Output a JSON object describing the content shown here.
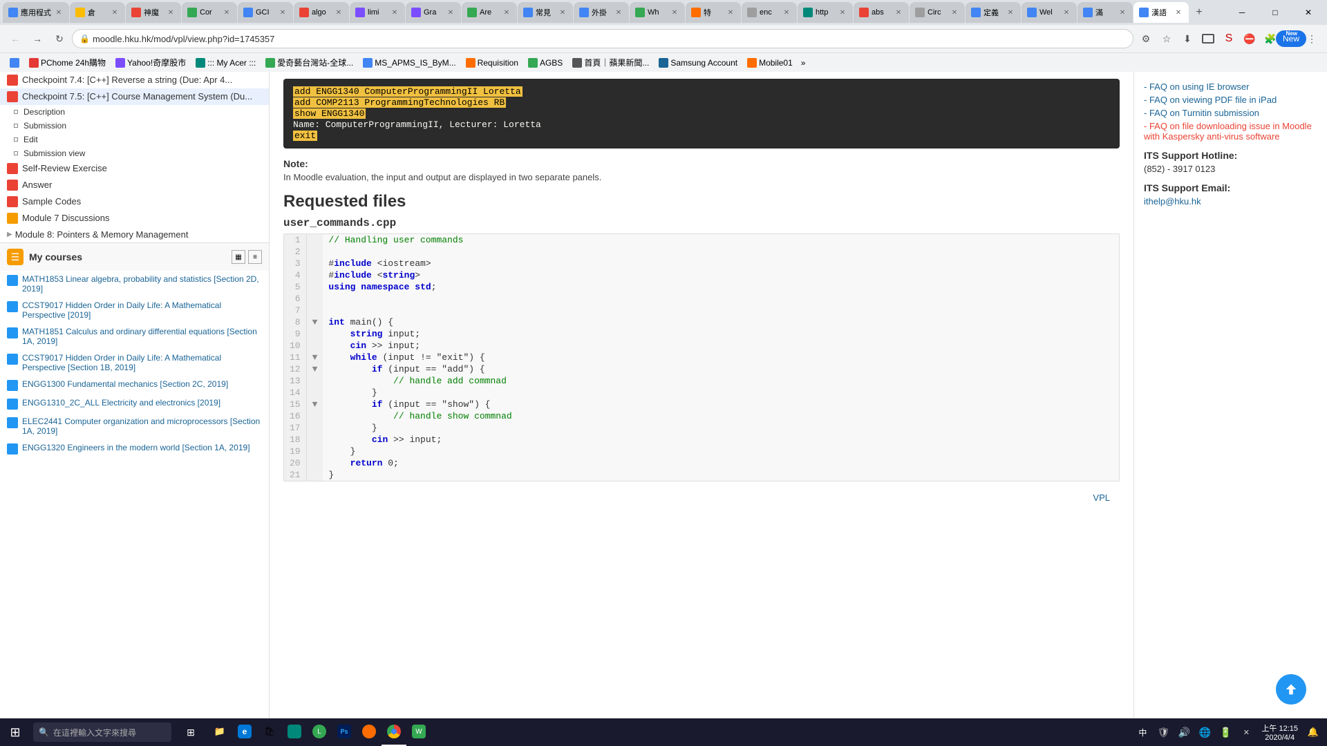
{
  "browser": {
    "tabs": [
      {
        "id": 1,
        "title": "應用程式",
        "favicon_color": "#4285f4",
        "active": false
      },
      {
        "id": 2,
        "title": "倉",
        "favicon_color": "#fbbc05",
        "active": false
      },
      {
        "id": 3,
        "title": "神魔",
        "favicon_color": "#ea4335",
        "active": false
      },
      {
        "id": 4,
        "title": "Cor",
        "favicon_color": "#34a853",
        "active": false
      },
      {
        "id": 5,
        "title": "GCI",
        "favicon_color": "#4285f4",
        "active": false
      },
      {
        "id": 6,
        "title": "algo",
        "favicon_color": "#ea4335",
        "active": false
      },
      {
        "id": 7,
        "title": "limi",
        "favicon_color": "#7c4dff",
        "active": false
      },
      {
        "id": 8,
        "title": "Gra",
        "favicon_color": "#7c4dff",
        "active": false
      },
      {
        "id": 9,
        "title": "Are",
        "favicon_color": "#34a853",
        "active": false
      },
      {
        "id": 10,
        "title": "常見",
        "favicon_color": "#4285f4",
        "active": false
      },
      {
        "id": 11,
        "title": "外掛",
        "favicon_color": "#4285f4",
        "active": false
      },
      {
        "id": 12,
        "title": "Wh",
        "favicon_color": "#34a853",
        "active": false
      },
      {
        "id": 13,
        "title": "特",
        "favicon_color": "#ff6d00",
        "active": false
      },
      {
        "id": 14,
        "title": "enc",
        "favicon_color": "#9e9e9e",
        "active": false
      },
      {
        "id": 15,
        "title": "http",
        "favicon_color": "#00897b",
        "active": false
      },
      {
        "id": 16,
        "title": "abs",
        "favicon_color": "#ea4335",
        "active": false
      },
      {
        "id": 17,
        "title": "Circ",
        "favicon_color": "#9e9e9e",
        "active": false
      },
      {
        "id": 18,
        "title": "定義",
        "favicon_color": "#4285f4",
        "active": false
      },
      {
        "id": 19,
        "title": "Wel",
        "favicon_color": "#4285f4",
        "active": false
      },
      {
        "id": 20,
        "title": "滿",
        "favicon_color": "#4285f4",
        "active": false
      },
      {
        "id": 21,
        "title": "漢語",
        "favicon_color": "#4285f4",
        "active": true
      }
    ],
    "address": "moodle.hku.hk/mod/vpl/view.php?id=1745357",
    "new_badge": "New"
  },
  "bookmarks": [
    {
      "label": "應用程式",
      "has_icon": true
    },
    {
      "label": "PChome 24h購物",
      "has_icon": true
    },
    {
      "label": "Yahoo!奇摩股市",
      "has_icon": true
    },
    {
      "label": "::: My Acer :::",
      "has_icon": true
    },
    {
      "label": "愛奇藝台灣站-全球...",
      "has_icon": true
    },
    {
      "label": "MS_APMS_IS_ByM...",
      "has_icon": true
    },
    {
      "label": "Requisition",
      "has_icon": true
    },
    {
      "label": "AGBS",
      "has_icon": true
    },
    {
      "label": "首頁｜蘋果新聞...",
      "has_icon": true
    },
    {
      "label": "Samsung Account",
      "has_icon": true
    },
    {
      "label": "Mobile01",
      "has_icon": true
    }
  ],
  "sidebar": {
    "checkpoint_74": {
      "label": "Checkpoint 7.4: [C++] Reverse a string (Due: Apr 4...",
      "icon_color": "#ea4335"
    },
    "checkpoint_75": {
      "label": "Checkpoint 7.5: [C++] Course Management System (Du...",
      "icon_color": "#ea4335",
      "active": true
    },
    "sub_items": [
      "Description",
      "Submission",
      "Edit",
      "Submission view"
    ],
    "self_review": {
      "label": "Self-Review Exercise",
      "icon_color": "#ea4335"
    },
    "answer": {
      "label": "Answer",
      "icon_color": "#ea4335"
    },
    "sample_codes": {
      "label": "Sample Codes",
      "icon_color": "#ea4335"
    },
    "module7_discussions": {
      "label": "Module 7 Discussions",
      "icon_color": "#f59c00"
    },
    "module8": {
      "label": "Module 8: Pointers & Memory Management"
    }
  },
  "my_courses": {
    "title": "My courses",
    "items": [
      {
        "label": "MATH1853 Linear algebra, probability and statistics [Section 2D, 2019]",
        "icon_color": "#2196F3"
      },
      {
        "label": "CCST9017 Hidden Order in Daily Life: A Mathematical Perspective [2019]",
        "icon_color": "#2196F3"
      },
      {
        "label": "MATH1851 Calculus and ordinary differential equations [Section 1A, 2019]",
        "icon_color": "#2196F3"
      },
      {
        "label": "CCST9017 Hidden Order in Daily Life: A Mathematical Perspective [Section 1B, 2019]",
        "icon_color": "#2196F3"
      },
      {
        "label": "ENGG1300 Fundamental mechanics [Section 2C, 2019]",
        "icon_color": "#2196F3"
      },
      {
        "label": "ENGG1310_2C_ALL Electricity and electronics [2019]",
        "icon_color": "#2196F3"
      },
      {
        "label": "ELEC2441 Computer organization and microprocessors [Section 1A, 2019]",
        "icon_color": "#2196F3"
      },
      {
        "label": "ENGG1320 Engineers in the modern world [Section 1A, 2019]",
        "icon_color": "#2196F3"
      }
    ]
  },
  "terminal": {
    "lines": [
      {
        "text": "add ENGG1340 ComputerProgrammingII Loretta",
        "highlight": true
      },
      {
        "text": "add COMP2113 ProgrammingTechnologies RB",
        "highlight": true
      },
      {
        "text": "show ENGG1340",
        "highlight": true
      },
      {
        "text": "Name: ComputerProgrammingII, Lecturer: Loretta",
        "highlight": false
      },
      {
        "text": "exit",
        "highlight": true
      }
    ]
  },
  "note": {
    "label": "Note:",
    "text": "In Moodle evaluation, the input and output are displayed in two separate panels."
  },
  "requested_files": {
    "heading": "Requested files",
    "filename": "user_commands.cpp",
    "vpl_link": "VPL",
    "code_lines": [
      {
        "num": 1,
        "collapse": false,
        "code": "// Handling user commands",
        "indent": 0
      },
      {
        "num": 2,
        "collapse": false,
        "code": "",
        "indent": 0
      },
      {
        "num": 3,
        "collapse": false,
        "code": "#include <iostream>",
        "indent": 0
      },
      {
        "num": 4,
        "collapse": false,
        "code": "#include <string>",
        "indent": 0
      },
      {
        "num": 5,
        "collapse": false,
        "code": "using namespace std;",
        "indent": 0
      },
      {
        "num": 6,
        "collapse": false,
        "code": "",
        "indent": 0
      },
      {
        "num": 7,
        "collapse": false,
        "code": "",
        "indent": 0
      },
      {
        "num": 8,
        "collapse": true,
        "code": "int main() {",
        "indent": 0
      },
      {
        "num": 9,
        "collapse": false,
        "code": "    string input;",
        "indent": 0
      },
      {
        "num": 10,
        "collapse": false,
        "code": "    cin >> input;",
        "indent": 0
      },
      {
        "num": 11,
        "collapse": true,
        "code": "    while (input != \"exit\") {",
        "indent": 0
      },
      {
        "num": 12,
        "collapse": true,
        "code": "        if (input == \"add\") {",
        "indent": 0
      },
      {
        "num": 13,
        "collapse": false,
        "code": "            // handle add commnad",
        "indent": 0
      },
      {
        "num": 14,
        "collapse": false,
        "code": "        }",
        "indent": 0
      },
      {
        "num": 15,
        "collapse": true,
        "code": "        if (input == \"show\") {",
        "indent": 0
      },
      {
        "num": 16,
        "collapse": false,
        "code": "            // handle show commnad",
        "indent": 0
      },
      {
        "num": 17,
        "collapse": false,
        "code": "        }",
        "indent": 0
      },
      {
        "num": 18,
        "collapse": false,
        "code": "        cin >> input;",
        "indent": 0
      },
      {
        "num": 19,
        "collapse": false,
        "code": "    }",
        "indent": 0
      },
      {
        "num": 20,
        "collapse": false,
        "code": "    return 0;",
        "indent": 0
      },
      {
        "num": 21,
        "collapse": false,
        "code": "}",
        "indent": 0
      }
    ]
  },
  "right_sidebar": {
    "links": [
      {
        "label": "- FAQ on using IE browser"
      },
      {
        "label": "- FAQ on viewing PDF file in iPad"
      },
      {
        "label": "- FAQ on Turnitin submission"
      },
      {
        "label": "- FAQ on file downloading issue in Moodle with Kaspersky anti-virus software"
      }
    ],
    "support_hotline_label": "ITS Support Hotline:",
    "support_hotline_number": "(852) - 3917 0123",
    "support_email_label": "ITS Support Email:",
    "support_email": "ithelp@hku.hk"
  },
  "taskbar": {
    "search_placeholder": "在這裡輸入文字來搜尋",
    "time": "上午 12:15",
    "date": "2020/4/4",
    "apps": [
      {
        "label": "File Explorer",
        "icon": "📁"
      },
      {
        "label": "Edge",
        "icon": "🌐"
      },
      {
        "label": "Store",
        "icon": "🛍"
      },
      {
        "label": "App1",
        "icon": "📧"
      },
      {
        "label": "Line",
        "icon": "💬"
      },
      {
        "label": "PS",
        "icon": "🎨"
      },
      {
        "label": "Browser1",
        "icon": "🌐"
      },
      {
        "label": "Chrome",
        "icon": "🔵"
      },
      {
        "label": "WeChat",
        "icon": "💬"
      }
    ]
  }
}
